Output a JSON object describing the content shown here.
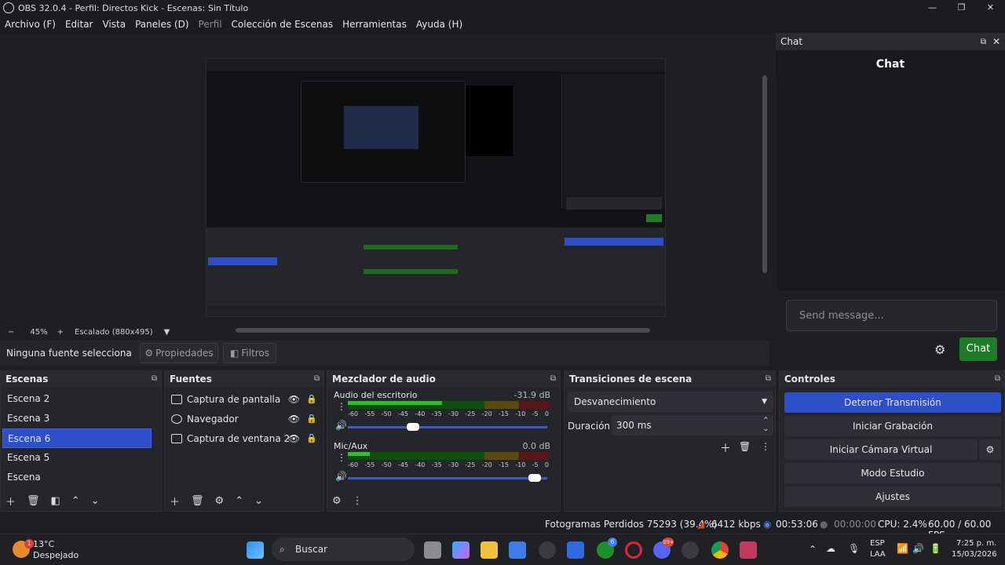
{
  "window": {
    "title": "OBS 32.0.4 - Perfil: Directos Kick - Escenas: Sin Título",
    "min": "—",
    "max": "❐",
    "close": "✕"
  },
  "menu": [
    "Archivo (F)",
    "Editar",
    "Vista",
    "Paneles (D)",
    "Perfil",
    "Colección de Escenas",
    "Herramientas",
    "Ayuda (H)"
  ],
  "preview": {
    "zoom_minus": "−",
    "zoom": "45%",
    "zoom_plus": "+",
    "scale": "Escalado (880x495)"
  },
  "sourcebar": {
    "none": "Ninguna fuente selecciona",
    "properties": "Propiedades",
    "filters": "Filtros"
  },
  "chat": {
    "dock_title": "Chat",
    "title": "Chat",
    "placeholder": "Send message...",
    "send": "Chat"
  },
  "scenes": {
    "title": "Escenas",
    "items": [
      "Escena 2",
      "Escena 3",
      "Escena 6",
      "Escena 5",
      "Escena"
    ],
    "selected": 2
  },
  "sources": {
    "title": "Fuentes",
    "items": [
      "Captura de pantalla",
      "Navegador",
      "Captura de ventana 2"
    ]
  },
  "mixer": {
    "title": "Mezclador de audio",
    "channels": [
      {
        "name": "Audio del escritorio",
        "db": "-31.9 dB",
        "level": 0.47,
        "volume": 0.36
      },
      {
        "name": "Mic/Aux",
        "db": "0.0 dB",
        "level": 0.11,
        "volume": 0.97
      }
    ],
    "ticks": [
      "-60",
      "-55",
      "-50",
      "-45",
      "-40",
      "-35",
      "-30",
      "-25",
      "-20",
      "-15",
      "-10",
      "-5",
      "0"
    ]
  },
  "transitions": {
    "title": "Transiciones de escena",
    "selected": "Desvanecimiento",
    "duration_label": "Duración",
    "duration": "300 ms"
  },
  "controls": {
    "title": "Controles",
    "buttons": [
      "Detener Transmisión",
      "Iniciar Grabación",
      "Iniciar Cámara Virtual",
      "Modo Estudio",
      "Ajustes"
    ]
  },
  "status": {
    "frames": "Fotogramas Perdidos 75293 (39.4%)",
    "kbps": "6412 kbps",
    "live": "00:53:06",
    "rec": "00:00:00",
    "cpu": "CPU: 2.4%",
    "fps": "60.00 / 60.00 FPS"
  },
  "taskbar": {
    "temp": "13°C",
    "weather": "Despejado",
    "search": "Buscar",
    "lang1": "ESP",
    "lang2": "LAA",
    "time": "7:25 p. m.",
    "date": "15/03/2026",
    "badge1": "1",
    "badge2": "6",
    "badge3": "99+"
  },
  "colors": {
    "accent": "#2d4fc9",
    "send": "#1e7b2a"
  }
}
